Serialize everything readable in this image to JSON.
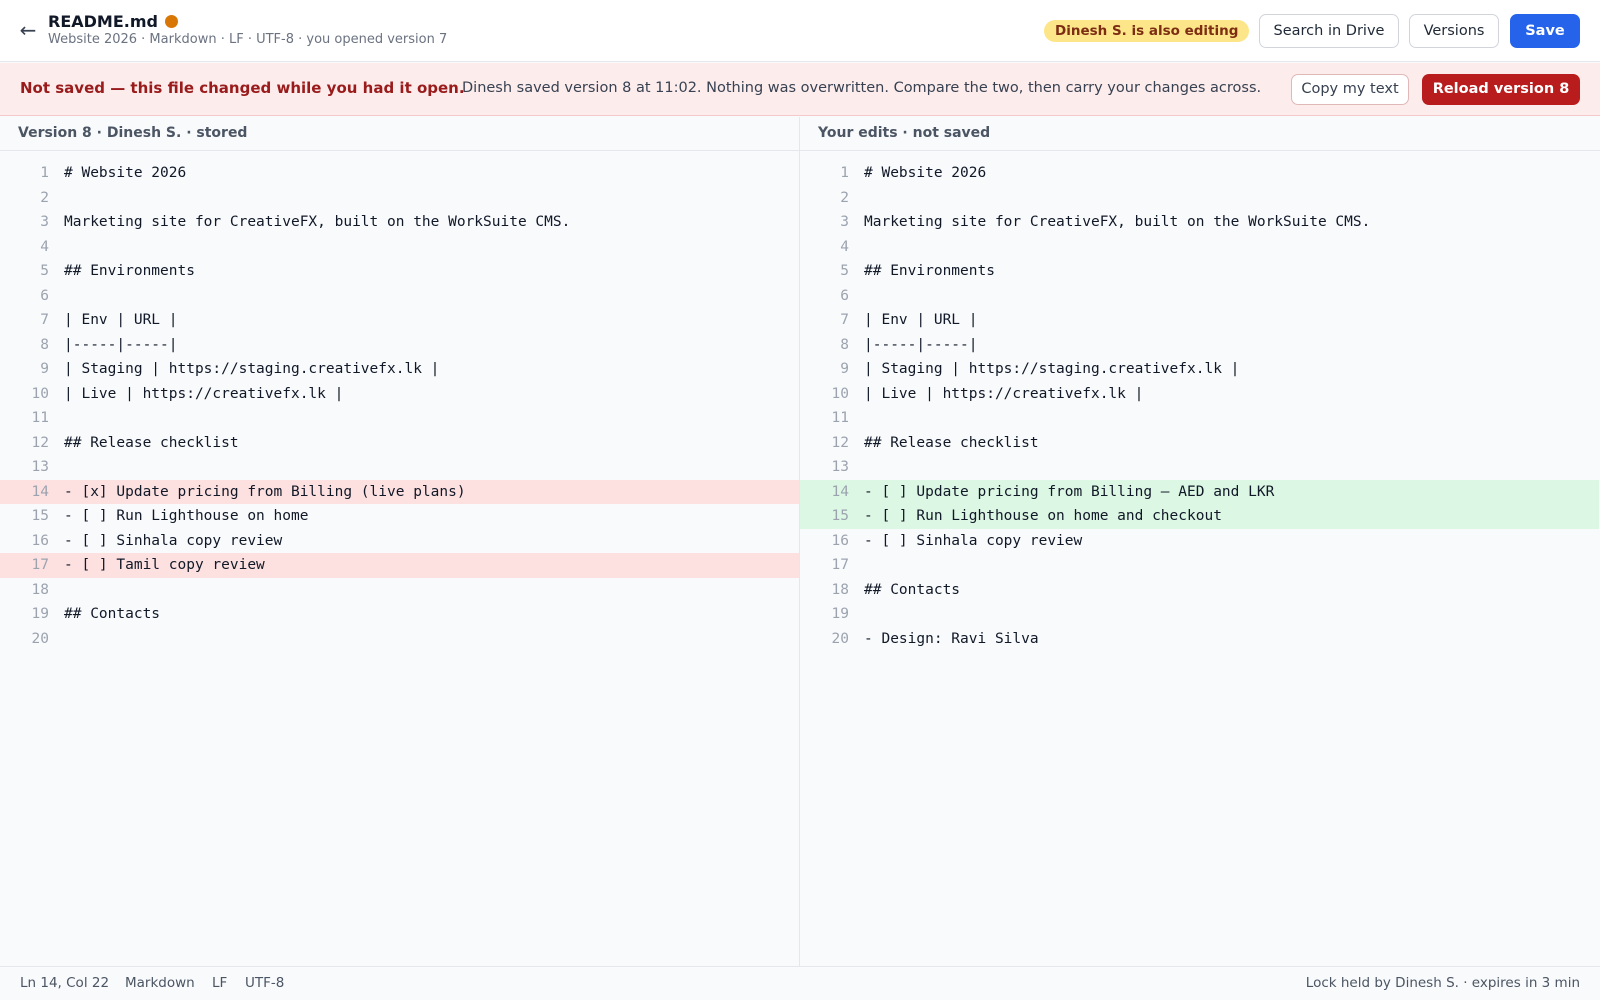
{
  "header": {
    "back_icon": "arrow-left-icon",
    "file_name": "README.md",
    "meta": "Website 2026 · Markdown · LF · UTF-8 · you opened version 7",
    "presence": "Dinesh S. is also editing",
    "search_label": "Search in Drive",
    "versions_label": "Versions",
    "save_label": "Save",
    "colors": {
      "save": "#2563eb",
      "unsaved_dot": "#d97706",
      "presence_bg": "#fde68a"
    }
  },
  "banner": {
    "title": "Not saved — this file changed while you had it open.",
    "message": "Dinesh saved version 8 at 11:02. Nothing was overwritten. Compare the two, then carry your changes across.",
    "copy_label": "Copy my text",
    "reload_label": "Reload version 8",
    "colors": {
      "background": "#fdecec",
      "reload": "#b91c1c"
    }
  },
  "left_pane": {
    "title": "Version 8 · Dinesh S. · stored",
    "lines": [
      {
        "n": "1",
        "text": "# Website 2026",
        "state": ""
      },
      {
        "n": "2",
        "text": "",
        "state": ""
      },
      {
        "n": "3",
        "text": "Marketing site for CreativeFX, built on the WorkSuite CMS.",
        "state": ""
      },
      {
        "n": "4",
        "text": "",
        "state": ""
      },
      {
        "n": "5",
        "text": "## Environments",
        "state": ""
      },
      {
        "n": "6",
        "text": "",
        "state": ""
      },
      {
        "n": "7",
        "text": "| Env | URL |",
        "state": ""
      },
      {
        "n": "8",
        "text": "|-----|-----|",
        "state": ""
      },
      {
        "n": "9",
        "text": "| Staging | https://staging.creativefx.lk |",
        "state": ""
      },
      {
        "n": "10",
        "text": "| Live | https://creativefx.lk |",
        "state": ""
      },
      {
        "n": "11",
        "text": "",
        "state": ""
      },
      {
        "n": "12",
        "text": "## Release checklist",
        "state": ""
      },
      {
        "n": "13",
        "text": "",
        "state": ""
      },
      {
        "n": "14",
        "text": "- [x] Update pricing from Billing (live plans)",
        "state": "removed"
      },
      {
        "n": "15",
        "text": "- [ ] Run Lighthouse on home",
        "state": ""
      },
      {
        "n": "16",
        "text": "- [ ] Sinhala copy review",
        "state": ""
      },
      {
        "n": "17",
        "text": "- [ ] Tamil copy review",
        "state": "removed"
      },
      {
        "n": "18",
        "text": "",
        "state": ""
      },
      {
        "n": "19",
        "text": "## Contacts",
        "state": ""
      },
      {
        "n": "20",
        "text": "",
        "state": ""
      }
    ]
  },
  "right_pane": {
    "title": "Your edits · not saved",
    "lines": [
      {
        "n": "1",
        "text": "# Website 2026",
        "state": ""
      },
      {
        "n": "2",
        "text": "",
        "state": ""
      },
      {
        "n": "3",
        "text": "Marketing site for CreativeFX, built on the WorkSuite CMS.",
        "state": ""
      },
      {
        "n": "4",
        "text": "",
        "state": ""
      },
      {
        "n": "5",
        "text": "## Environments",
        "state": ""
      },
      {
        "n": "6",
        "text": "",
        "state": ""
      },
      {
        "n": "7",
        "text": "| Env | URL |",
        "state": ""
      },
      {
        "n": "8",
        "text": "|-----|-----|",
        "state": ""
      },
      {
        "n": "9",
        "text": "| Staging | https://staging.creativefx.lk |",
        "state": ""
      },
      {
        "n": "10",
        "text": "| Live | https://creativefx.lk |",
        "state": ""
      },
      {
        "n": "11",
        "text": "",
        "state": ""
      },
      {
        "n": "12",
        "text": "## Release checklist",
        "state": ""
      },
      {
        "n": "13",
        "text": "",
        "state": ""
      },
      {
        "n": "14",
        "text": "- [ ] Update pricing from Billing — AED and LKR",
        "state": "added"
      },
      {
        "n": "15",
        "text": "- [ ] Run Lighthouse on home and checkout",
        "state": "added"
      },
      {
        "n": "16",
        "text": "- [ ] Sinhala copy review",
        "state": ""
      },
      {
        "n": "17",
        "text": "",
        "state": ""
      },
      {
        "n": "18",
        "text": "## Contacts",
        "state": ""
      },
      {
        "n": "19",
        "text": "",
        "state": ""
      },
      {
        "n": "20",
        "text": "- Design: Ravi Silva",
        "state": ""
      }
    ]
  },
  "status": {
    "cursor": "Ln 14, Col 22",
    "language": "Markdown",
    "line_ending": "LF",
    "encoding": "UTF-8",
    "lock": "Lock held by Dinesh S. · expires in 3 min"
  }
}
